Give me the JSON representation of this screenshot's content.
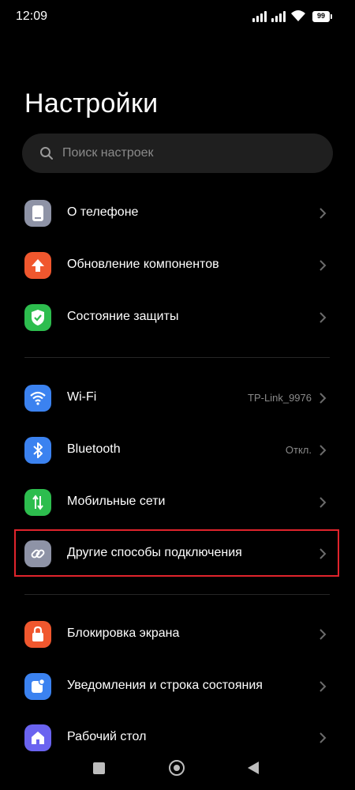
{
  "status_bar": {
    "time": "12:09",
    "battery": "99"
  },
  "page": {
    "title": "Настройки"
  },
  "search": {
    "placeholder": "Поиск настроек"
  },
  "items": [
    {
      "label": "О телефоне",
      "value": "",
      "icon": "phone-icon",
      "color": "#8e93a6"
    },
    {
      "label": "Обновление компонентов",
      "value": "",
      "icon": "arrow-up-icon",
      "color": "#f0572e"
    },
    {
      "label": "Состояние защиты",
      "value": "",
      "icon": "shield-check-icon",
      "color": "#2dbd4e"
    },
    {
      "label": "Wi-Fi",
      "value": "TP-Link_9976",
      "icon": "wifi-icon",
      "color": "#3b82f0"
    },
    {
      "label": "Bluetooth",
      "value": "Откл.",
      "icon": "bluetooth-icon",
      "color": "#3b82f0"
    },
    {
      "label": "Мобильные сети",
      "value": "",
      "icon": "mobile-data-icon",
      "color": "#2dbd4e"
    },
    {
      "label": "Другие способы подключения",
      "value": "",
      "icon": "link-icon",
      "color": "#8e93a6"
    },
    {
      "label": "Блокировка экрана",
      "value": "",
      "icon": "lock-icon",
      "color": "#f0572e"
    },
    {
      "label": "Уведомления и строка состояния",
      "value": "",
      "icon": "notification-icon",
      "color": "#3b82f0"
    },
    {
      "label": "Рабочий стол",
      "value": "",
      "icon": "home-icon",
      "color": "#6a63f0"
    }
  ],
  "highlight_color": "#e0242c"
}
